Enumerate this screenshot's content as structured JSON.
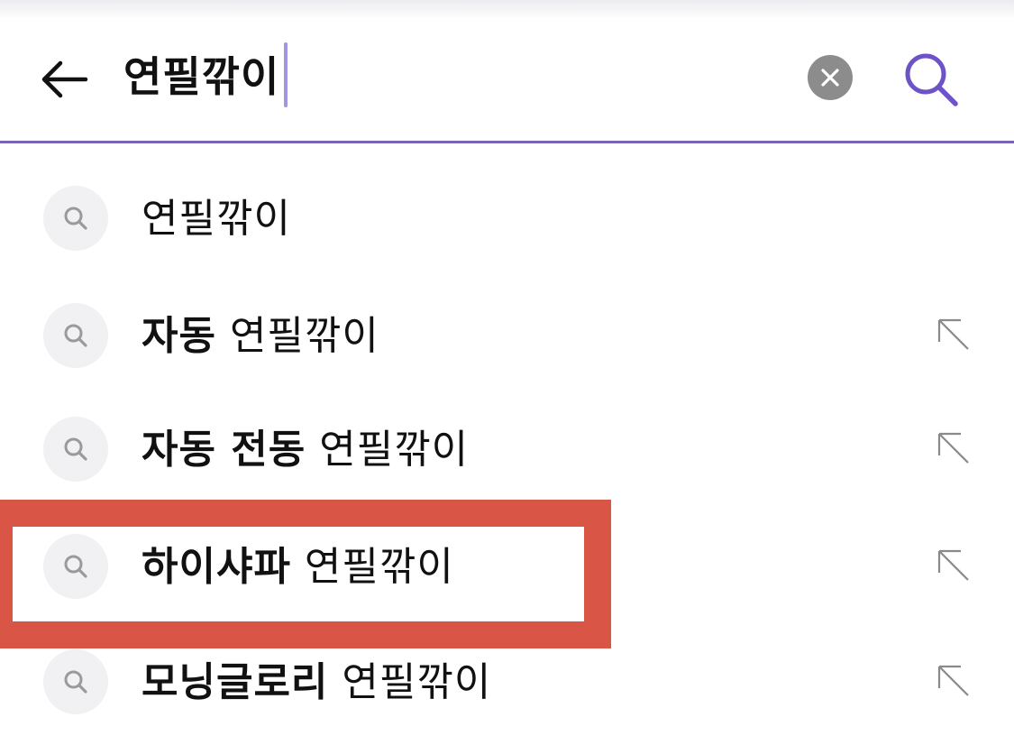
{
  "search_bar": {
    "query": "연필깎이",
    "back_icon": "arrow-left-icon",
    "clear_icon": "close-circle-icon",
    "search_icon": "search-icon",
    "accent_color": "#6e53c8"
  },
  "suggestions": [
    {
      "bold": "",
      "rest": "연필깎이",
      "fill_icon": false
    },
    {
      "bold": "자동",
      "rest": " 연필깎이",
      "fill_icon": true
    },
    {
      "bold": "자동 전동",
      "rest": " 연필깎이",
      "fill_icon": true
    },
    {
      "bold": "하이샤파",
      "rest": " 연필깎이",
      "fill_icon": true
    },
    {
      "bold": "모닝글로리",
      "rest": " 연필깎이",
      "fill_icon": true
    }
  ],
  "highlight": {
    "target_index": 3,
    "color": "#d95545"
  }
}
